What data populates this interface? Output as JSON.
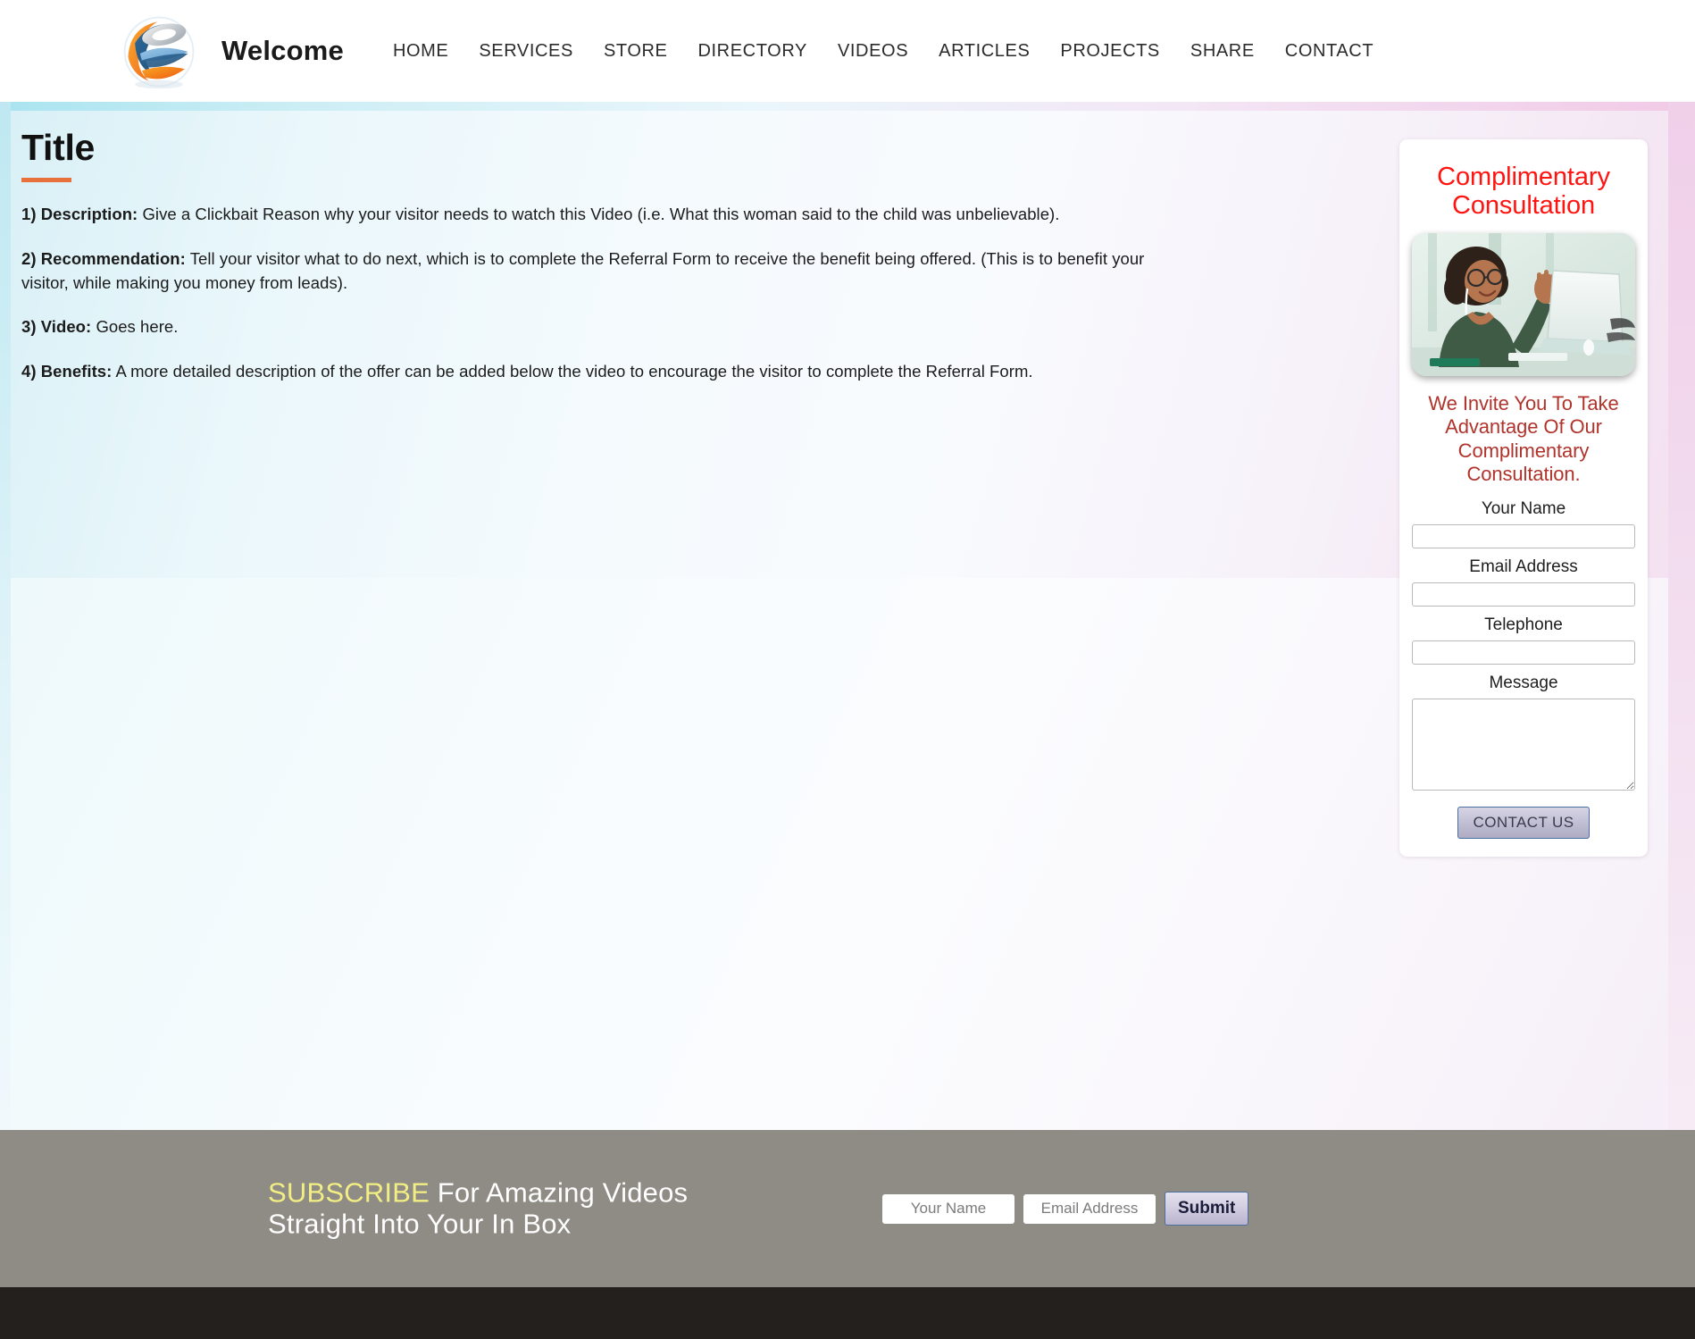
{
  "header": {
    "brand": "Welcome",
    "logo_icon": "globe-swirl-logo",
    "nav": [
      {
        "label": "HOME"
      },
      {
        "label": "SERVICES"
      },
      {
        "label": "STORE"
      },
      {
        "label": "DIRECTORY"
      },
      {
        "label": "VIDEOS"
      },
      {
        "label": "ARTICLES"
      },
      {
        "label": "PROJECTS"
      },
      {
        "label": "SHARE"
      },
      {
        "label": "CONTACT"
      }
    ]
  },
  "main": {
    "title": "Title",
    "accent_color": "#e8703a",
    "paragraphs": [
      {
        "label": "1) Description:",
        "text": " Give a Clickbait Reason why your visitor needs to watch this Video (i.e. What this woman said to the child was unbelievable)."
      },
      {
        "label": "2) Recommendation:",
        "text": " Tell your visitor what to do next, which is to complete the Referral Form to receive the benefit being offered. (This is to benefit your visitor, while making you money from leads)."
      },
      {
        "label": "3) Video:",
        "text": " Goes here."
      },
      {
        "label": "4) Benefits:",
        "text": " A more detailed description of the offer can be added below the video to encourage the visitor to complete the Referral Form."
      }
    ]
  },
  "sidebar": {
    "heading": "Complimentary Consultation",
    "heading_color": "#ff1410",
    "photo_alt": "woman-waving-at-laptop-photo",
    "invite_text": "We Invite You To Take Advantage Of Our Complimentary Consultation.",
    "invite_color": "#b0332c",
    "fields": [
      {
        "label": "Your Name",
        "value": "",
        "type": "text"
      },
      {
        "label": "Email Address",
        "value": "",
        "type": "text"
      },
      {
        "label": "Telephone",
        "value": "",
        "type": "text"
      },
      {
        "label": "Message",
        "value": "",
        "type": "textarea"
      }
    ],
    "submit_label": "CONTACT US"
  },
  "footer": {
    "subscribe_highlight": "SUBSCRIBE",
    "subscribe_line1_rest": " For Amazing Videos",
    "subscribe_line2": "Straight Into Your In Box",
    "highlight_color": "#f2ee84",
    "name_placeholder": "Your Name",
    "email_placeholder": "Email Address",
    "name_value": "",
    "email_value": "",
    "submit_label": "Submit"
  }
}
